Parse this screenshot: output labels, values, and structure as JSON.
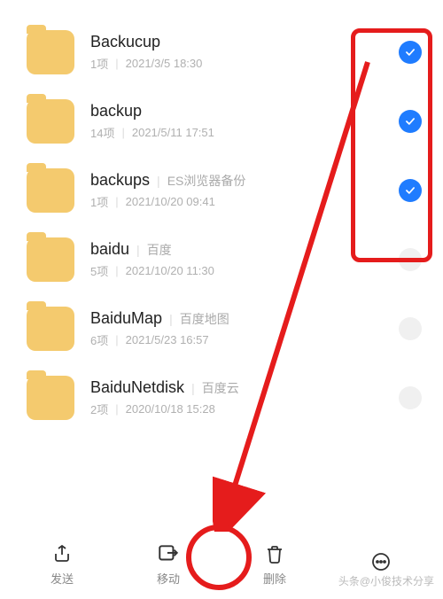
{
  "files": [
    {
      "name": "Backucup",
      "tag": "",
      "count": "1项",
      "date": "2021/3/5 18:30",
      "selected": true
    },
    {
      "name": "backup",
      "tag": "",
      "count": "14项",
      "date": "2021/5/11 17:51",
      "selected": true
    },
    {
      "name": "backups",
      "tag": "ES浏览器备份",
      "count": "1项",
      "date": "2021/10/20 09:41",
      "selected": true
    },
    {
      "name": "baidu",
      "tag": "百度",
      "count": "5项",
      "date": "2021/10/20 11:30",
      "selected": false
    },
    {
      "name": "BaiduMap",
      "tag": "百度地图",
      "count": "6项",
      "date": "2021/5/23 16:57",
      "selected": false
    },
    {
      "name": "BaiduNetdisk",
      "tag": "百度云",
      "count": "2项",
      "date": "2020/10/18 15:28",
      "selected": false
    }
  ],
  "toolbar": {
    "send": "发送",
    "move": "移动",
    "delete": "删除"
  },
  "watermark": "头条@小俊技术分享",
  "colors": {
    "accent": "#1f7cff",
    "folder": "#f4ca6e",
    "annotation": "#e51c1c"
  }
}
